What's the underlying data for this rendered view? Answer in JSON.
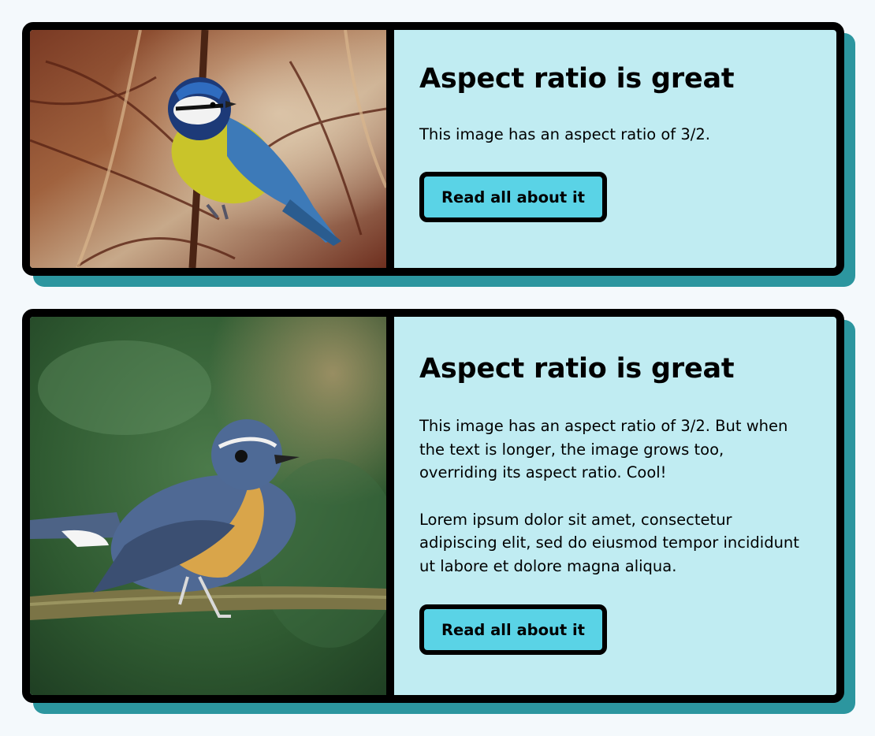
{
  "cards": [
    {
      "title": "Aspect ratio is great",
      "paragraphs": [
        "This image has an aspect ratio of 3/2."
      ],
      "button_label": "Read all about it",
      "image": "blue-tit-bird-photo"
    },
    {
      "title": "Aspect ratio is great",
      "paragraphs": [
        "This image has an aspect ratio of 3/2. But when the text is longer, the image grows too, overriding its aspect ratio. Cool!",
        "Lorem ipsum dolor sit amet, consectetur adipiscing elit, sed do eiusmod tempor incididunt ut labore et dolore magna aliqua."
      ],
      "button_label": "Read all about it",
      "image": "blue-flycatcher-bird-photo"
    }
  ],
  "colors": {
    "page_bg": "#f4f9fc",
    "card_bg": "#c0ecf2",
    "shadow": "#2c969f",
    "button_bg": "#5ad3e6",
    "border": "#000000"
  }
}
